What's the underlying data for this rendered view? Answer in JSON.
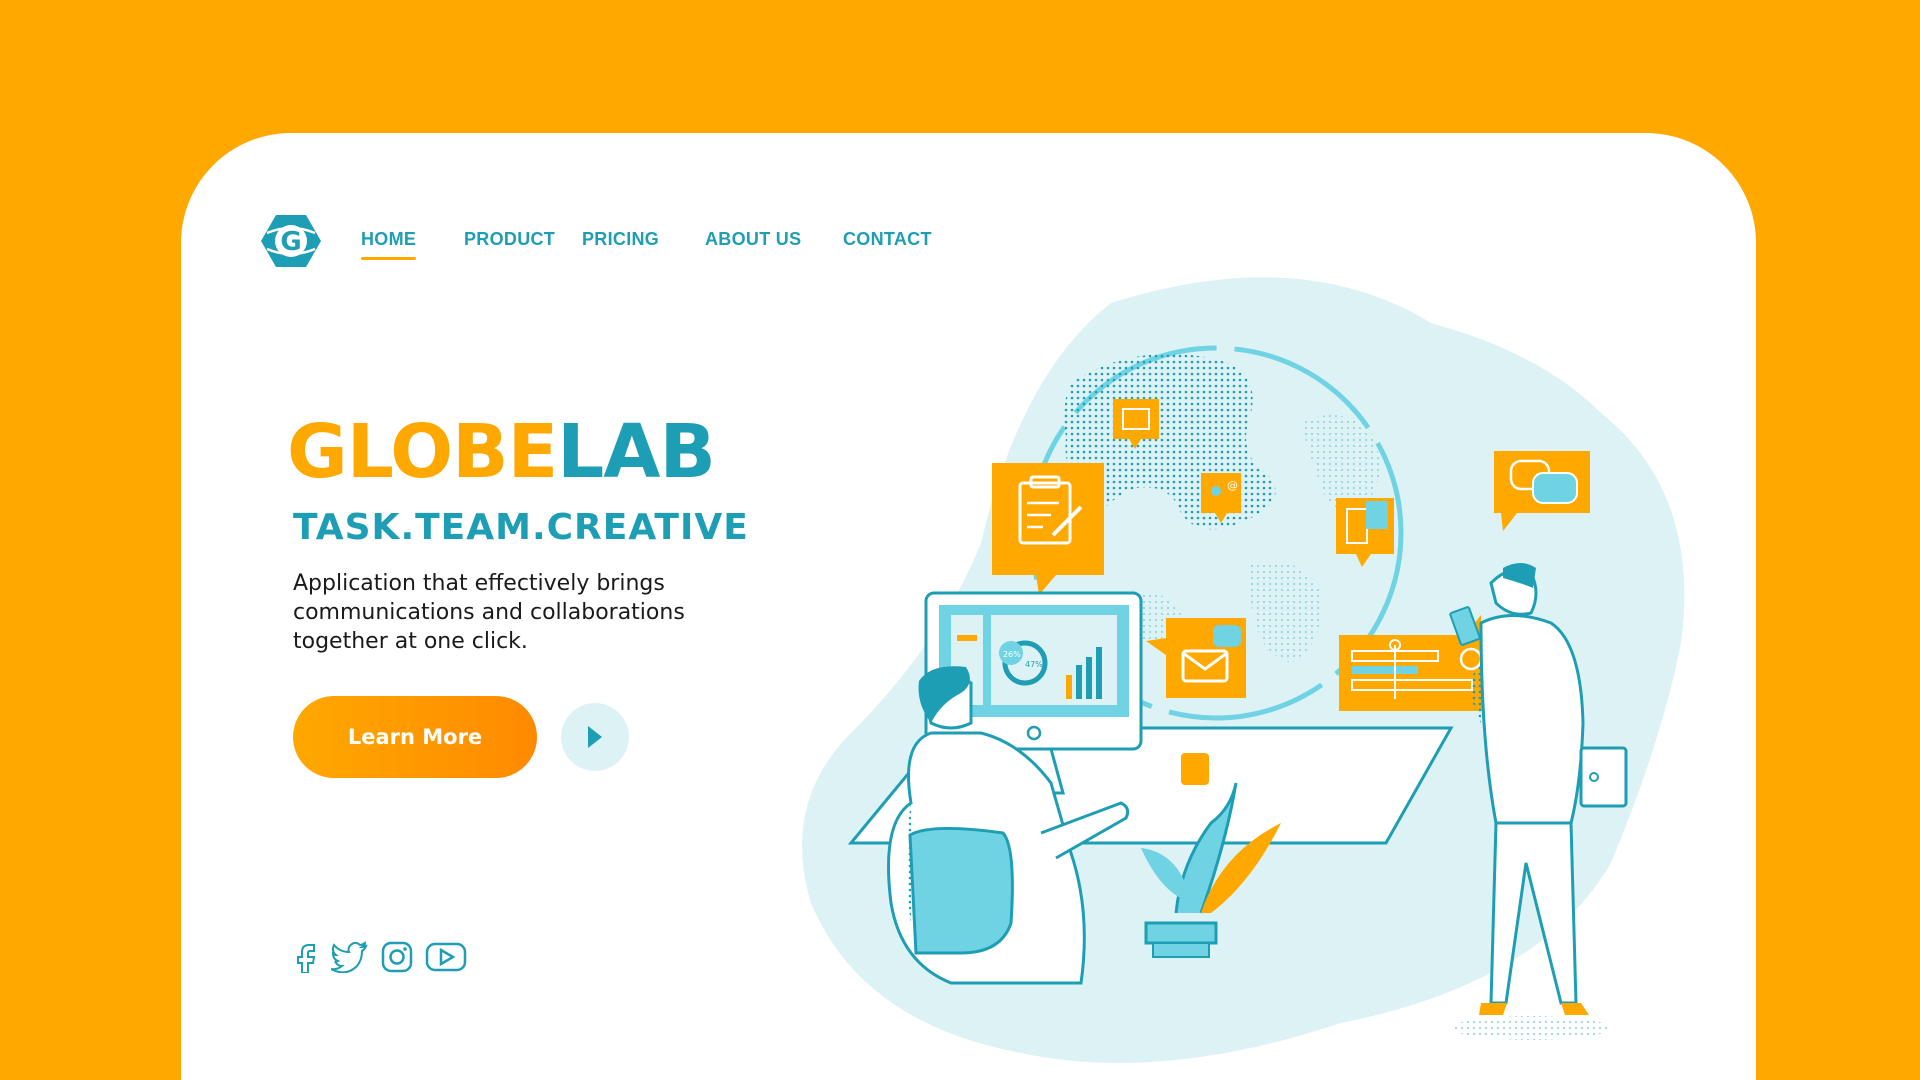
{
  "colors": {
    "background": "#FFA800",
    "accent_orange": "#FFA800",
    "accent_teal": "#1E9EB4",
    "light_teal": "#DDF2F5",
    "card": "#FFFFFF"
  },
  "logo": {
    "letter": "G",
    "icon": "globe-logo-icon"
  },
  "nav": {
    "items": [
      {
        "label": "HOME",
        "active": true
      },
      {
        "label": "PRODUCT",
        "active": false
      },
      {
        "label": "PRICING",
        "active": false
      },
      {
        "label": "ABOUT US",
        "active": false
      },
      {
        "label": "CONTACT",
        "active": false
      }
    ]
  },
  "hero": {
    "brand_part1": "GLOBE",
    "brand_part2": "LAB",
    "tagline": "TASK.TEAM.CREATIVE",
    "description": "Application that effectively brings communications and collaborations together at one click.",
    "cta_label": "Learn More",
    "play_icon": "play-icon"
  },
  "illustration": {
    "chart_labels": [
      "26%",
      "47%"
    ]
  },
  "social": [
    "facebook-icon",
    "twitter-icon",
    "instagram-icon",
    "youtube-icon"
  ]
}
